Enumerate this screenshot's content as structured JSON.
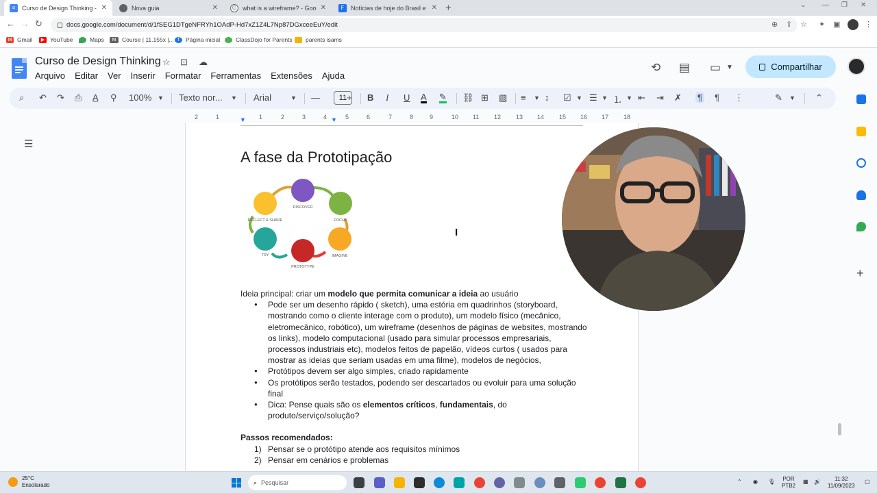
{
  "browser": {
    "tabs": [
      {
        "title": "Curso de Design Thinking - Doc",
        "active": true,
        "icon": "docs-icon",
        "color": "#4285f4"
      },
      {
        "title": "Nova guia",
        "active": false,
        "icon": "chrome-icon",
        "color": "#5f6368"
      },
      {
        "title": "what is a wireframe? - Google Se",
        "active": false,
        "icon": "google-icon",
        "color": "#5f6368"
      },
      {
        "title": "Notícias de hoje do Brasil e do M",
        "active": false,
        "icon": "news-icon",
        "color": "#1a73e8"
      }
    ],
    "url": "docs.google.com/document/d/1fSEG1DTgeNFRYh1OAdP-Hd7xZ1Z4L7Np87DGxceeEuY/edit",
    "bookmarks": [
      "Gmail",
      "YouTube",
      "Maps",
      "Course | 11.155x |...",
      "Página inicial",
      "ClassDojo for Parents",
      "parents isams"
    ]
  },
  "docs": {
    "title": "Curso de Design Thinking",
    "menu": [
      "Arquivo",
      "Editar",
      "Ver",
      "Inserir",
      "Formatar",
      "Ferramentas",
      "Extensões",
      "Ajuda"
    ],
    "share_label": "Compartilhar",
    "zoom": "100%",
    "style": "Texto nor...",
    "font": "Arial",
    "font_size": "11",
    "accent": "#c2e7ff"
  },
  "ruler": [
    "2",
    "1",
    "1",
    "2",
    "3",
    "4",
    "5",
    "6",
    "7",
    "8",
    "9",
    "10",
    "11",
    "12",
    "13",
    "14",
    "15",
    "16",
    "17",
    "18"
  ],
  "cycle_labels": [
    "DISCOVER",
    "FOCUS",
    "IMAGINE",
    "PROTOTYPE",
    "TRY",
    "REFLECT & SHARE"
  ],
  "document": {
    "heading": "A fase da Prototipação",
    "intro_prefix": "Ideia principal: criar um ",
    "intro_bold": "modelo que permita comunicar a ideia",
    "intro_suffix": " ao usuário",
    "bullet1": "Pode ser um desenho rápido ( sketch), uma estória em quadrinhos (storyboard, mostrando como o cliente interage com o produto),  um modelo físico (mecânico, eletromecânico, robótico), um wireframe (desenhos de páginas de websites, mostrando os links), modelo computacional (usado para simular processos empresariais, processos industriais etc),  modelos feitos de papelão, vídeos curtos ( usados para mostrar as ideias que seriam usadas em uma filme), modelos de negócios,",
    "bullet2": "Protótipos devem ser algo simples, criado rapidamente",
    "bullet3": "Os protótipos serão testados, podendo ser descartados ou evoluir para uma solução final",
    "bullet4_prefix": "Dica: Pense quais são os ",
    "bullet4_bold1": "elementos críticos",
    "bullet4_sep": ", ",
    "bullet4_bold2": "fundamentais",
    "bullet4_suffix": ", do produto/serviço/solução?",
    "steps_heading": "Passos recomendados:",
    "steps": [
      {
        "n": "1)",
        "text": "Pensar se o protótipo atende aos requisitos mínimos"
      },
      {
        "n": "2)",
        "text": "Pensar em cenários e problemas"
      }
    ]
  },
  "taskbar": {
    "temp": "25°C",
    "weather": "Ensolarado",
    "search": "Pesquisar",
    "lang1": "POR",
    "lang2": "PTB2",
    "time": "11:32",
    "date": "11/09/2023"
  }
}
